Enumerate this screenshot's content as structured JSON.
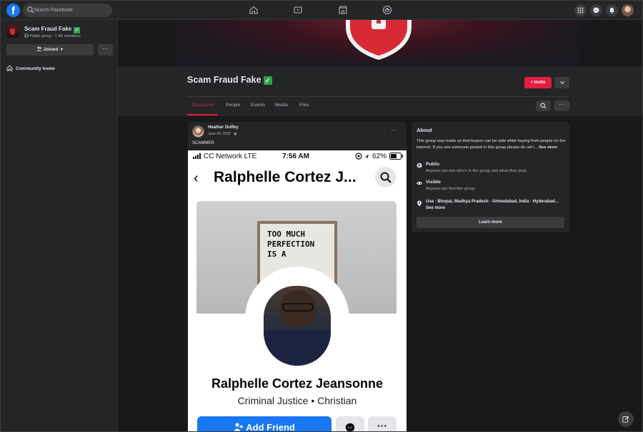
{
  "topbar": {
    "logo": "f",
    "search_placeholder": "Search Facebook",
    "nav_icons": [
      "home-icon",
      "watch-icon",
      "marketplace-icon",
      "groups-icon"
    ],
    "right_icons": [
      "menu-grid-icon",
      "messenger-icon",
      "notifications-icon",
      "account-avatar"
    ]
  },
  "sidebar": {
    "group_name": "Scam Fraud Fake",
    "group_meta": "Public group · 1.8K members",
    "joined_label": "Joined",
    "more_label": "···",
    "community_home": "Community home"
  },
  "header": {
    "title": "Scam Fraud Fake",
    "invite_label": "+ Invite",
    "tabs": [
      {
        "label": "Discussion",
        "active": true
      },
      {
        "label": "People",
        "active": false
      },
      {
        "label": "Events",
        "active": false
      },
      {
        "label": "Media",
        "active": false
      },
      {
        "label": "Files",
        "active": false
      }
    ],
    "more_label": "···"
  },
  "post": {
    "author": "Heather Duffey",
    "date": "June 24, 2020 · ",
    "more": "···",
    "text": "SCAMMER",
    "phone": {
      "carrier": "CC Network  LTE",
      "time": "7:56 AM",
      "battery": "62%",
      "top_name": "Ralphelle Cortez J...",
      "board_text": "TOO MUCH\nPERFECTION\nIS A",
      "full_name": "Ralphelle Cortez Jeansonne",
      "bio": "Criminal Justice • Christian",
      "add_friend": "Add Friend",
      "more": "···"
    }
  },
  "about": {
    "title": "About",
    "description": "This group was made so that buyers can be safe while buying from people on the internet. If you see someone posted in this group please do not l...",
    "see_more": "See more",
    "public_label": "Public",
    "public_sub": "Anyone can see who's in the group and what they post.",
    "visible_label": "Visible",
    "visible_sub": "Anyone can find this group.",
    "location": "Usa · Bhopal, Madhya Pradesh · Ahmedabad, India · Hyderabad...",
    "location_see_more": "See more",
    "learn_more": "Learn more"
  },
  "colors": {
    "accent": "#e41e3f",
    "brand": "#1877f2",
    "verified": "#31a24c"
  }
}
